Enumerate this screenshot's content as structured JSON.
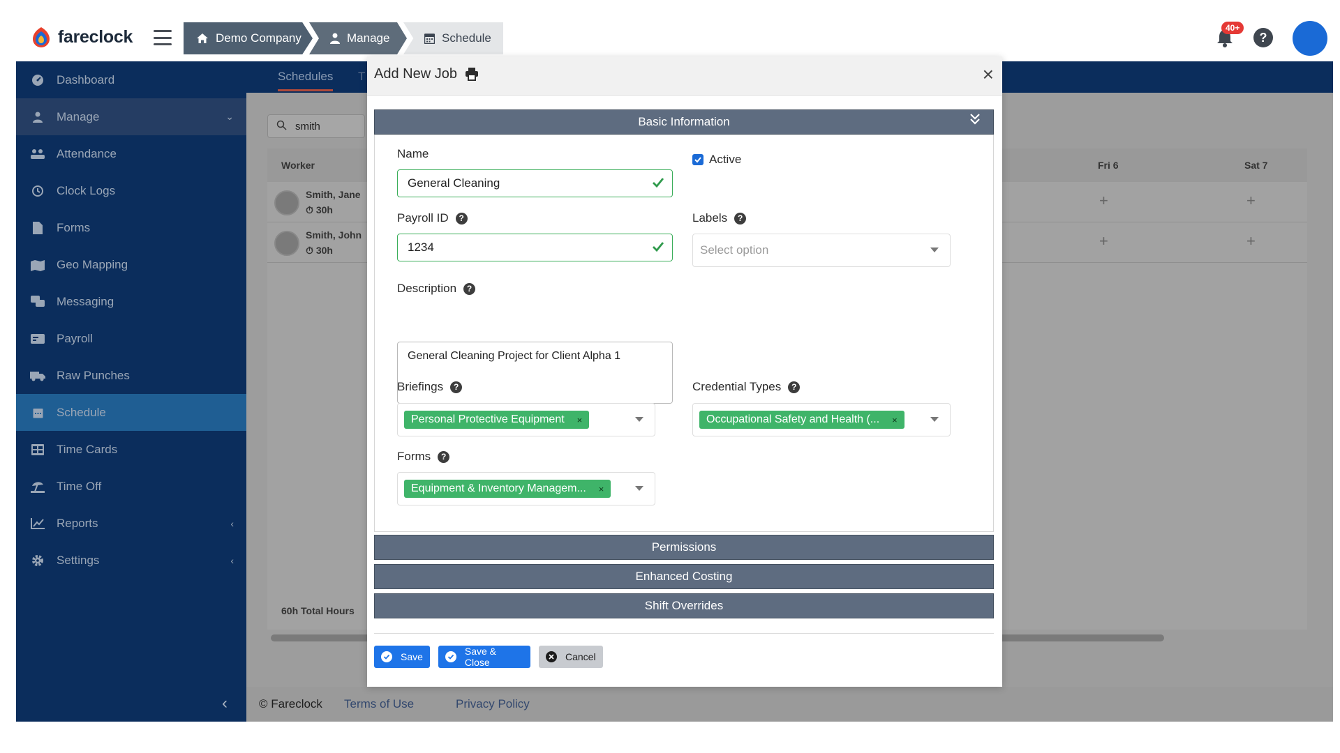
{
  "app": {
    "name": "fareclock",
    "notification_count": "40+",
    "help_label": "?"
  },
  "breadcrumb": [
    {
      "label": "Demo Company",
      "icon": "home-icon"
    },
    {
      "label": "Manage",
      "icon": "user-icon"
    },
    {
      "label": "Schedule",
      "icon": "calendar-icon"
    }
  ],
  "sidebar": {
    "items": [
      {
        "label": "Dashboard",
        "icon": "dashboard-icon"
      },
      {
        "label": "Manage",
        "icon": "user-icon",
        "chevron": "⌄"
      },
      {
        "label": "Attendance",
        "icon": "attendance-icon"
      },
      {
        "label": "Clock Logs",
        "icon": "history-icon"
      },
      {
        "label": "Forms",
        "icon": "file-icon"
      },
      {
        "label": "Geo Mapping",
        "icon": "map-icon"
      },
      {
        "label": "Messaging",
        "icon": "chat-icon"
      },
      {
        "label": "Payroll",
        "icon": "payroll-icon"
      },
      {
        "label": "Raw Punches",
        "icon": "truck-icon"
      },
      {
        "label": "Schedule",
        "icon": "calendar-icon"
      },
      {
        "label": "Time Cards",
        "icon": "table-icon"
      },
      {
        "label": "Time Off",
        "icon": "beach-icon"
      },
      {
        "label": "Reports",
        "icon": "chart-icon",
        "chevron": "‹"
      },
      {
        "label": "Settings",
        "icon": "gear-icon",
        "chevron": "‹"
      }
    ],
    "collapse_glyph": "‹"
  },
  "main": {
    "tabs": [
      "Schedules",
      "T"
    ],
    "search_value": "smith",
    "grid": {
      "headers": {
        "worker": "Worker",
        "fri": "Fri 6",
        "sat": "Sat 7"
      },
      "rows": [
        {
          "name": "Smith, Jane",
          "hours": "30h"
        },
        {
          "name": "Smith, John",
          "hours": "30h"
        }
      ],
      "total": "60h Total Hours"
    },
    "footer": {
      "copyright": "© Fareclock",
      "terms": "Terms of Use",
      "privacy": "Privacy Policy"
    }
  },
  "modal": {
    "title": "Add New Job",
    "close_glyph": "×",
    "sections": {
      "basic": "Basic Information",
      "permissions": "Permissions",
      "costing": "Enhanced Costing",
      "overrides": "Shift Overrides"
    },
    "fields": {
      "name_label": "Name",
      "name_value": "General Cleaning",
      "active_label": "Active",
      "active_checked": true,
      "payroll_label": "Payroll ID",
      "payroll_value": "1234",
      "labels_label": "Labels",
      "labels_placeholder": "Select option",
      "description_label": "Description",
      "description_value": "General Cleaning Project for Client Alpha 1",
      "briefings_label": "Briefings",
      "briefings_chip": "Personal Protective Equipment",
      "credential_label": "Credential Types",
      "credential_chip": "Occupational Safety and Health (...",
      "forms_label": "Forms",
      "forms_chip": "Equipment & Inventory Managem...",
      "chip_remove": "×"
    },
    "buttons": {
      "save": "Save",
      "save_close": "Save & Close",
      "cancel": "Cancel"
    }
  },
  "colors": {
    "sidebar_bg": "#0b2d5c",
    "sidebar_active": "#1f5e93",
    "accordion_header": "#5e6c80",
    "chip_green": "#3fb469",
    "primary_blue": "#1e74e8",
    "valid_green": "#3cae5a"
  }
}
